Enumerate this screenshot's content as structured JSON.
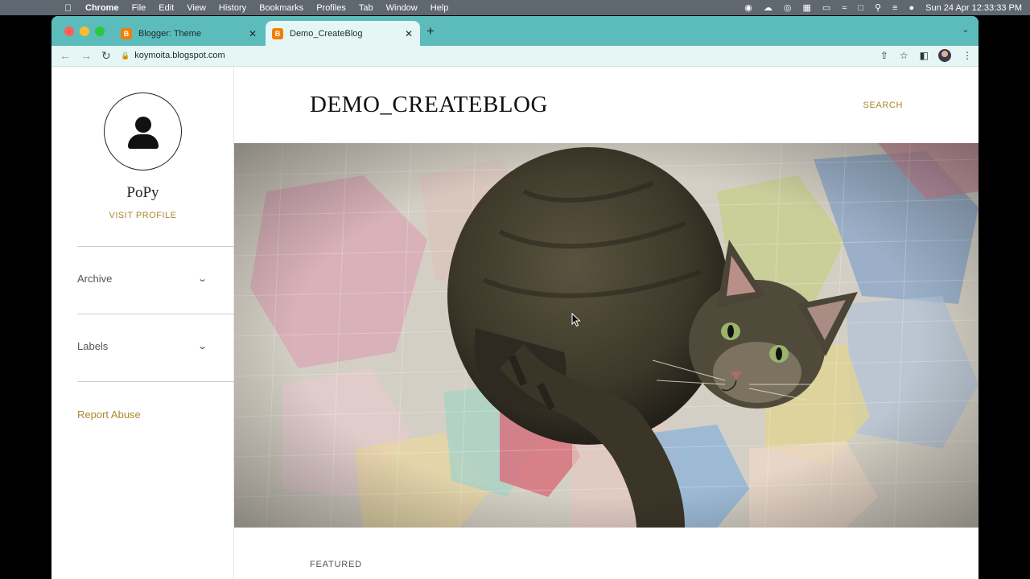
{
  "menubar": {
    "app_name": "Chrome",
    "menus": [
      "File",
      "Edit",
      "View",
      "History",
      "Bookmarks",
      "Profiles",
      "Tab",
      "Window",
      "Help"
    ],
    "clock": "Sun 24 Apr  12:33:33 PM",
    "status_icons": [
      "record-icon",
      "cloud-icon",
      "vpn-icon",
      "keyboard-icon",
      "battery-icon",
      "wifi-icon",
      "input-source-icon",
      "spotlight-icon",
      "control-center-icon",
      "siri-icon"
    ]
  },
  "tabs": [
    {
      "title": "Blogger: Theme",
      "active": false
    },
    {
      "title": "Demo_CreateBlog",
      "active": true
    }
  ],
  "address_bar": {
    "url": "koymoita.blogspot.com"
  },
  "sidebar": {
    "profile_name": "PoPy",
    "visit_profile": "VISIT PROFILE",
    "sections": [
      {
        "label": "Archive"
      },
      {
        "label": "Labels"
      }
    ],
    "report_abuse": "Report Abuse"
  },
  "main": {
    "blog_title": "DEMO_CREATEBLOG",
    "search_label": "SEARCH",
    "featured_label": "FEATURED"
  },
  "colors": {
    "tabstrip": "#5bbcbb",
    "toolbar": "#e5f6f5",
    "link_gold": "#a88a2e"
  }
}
